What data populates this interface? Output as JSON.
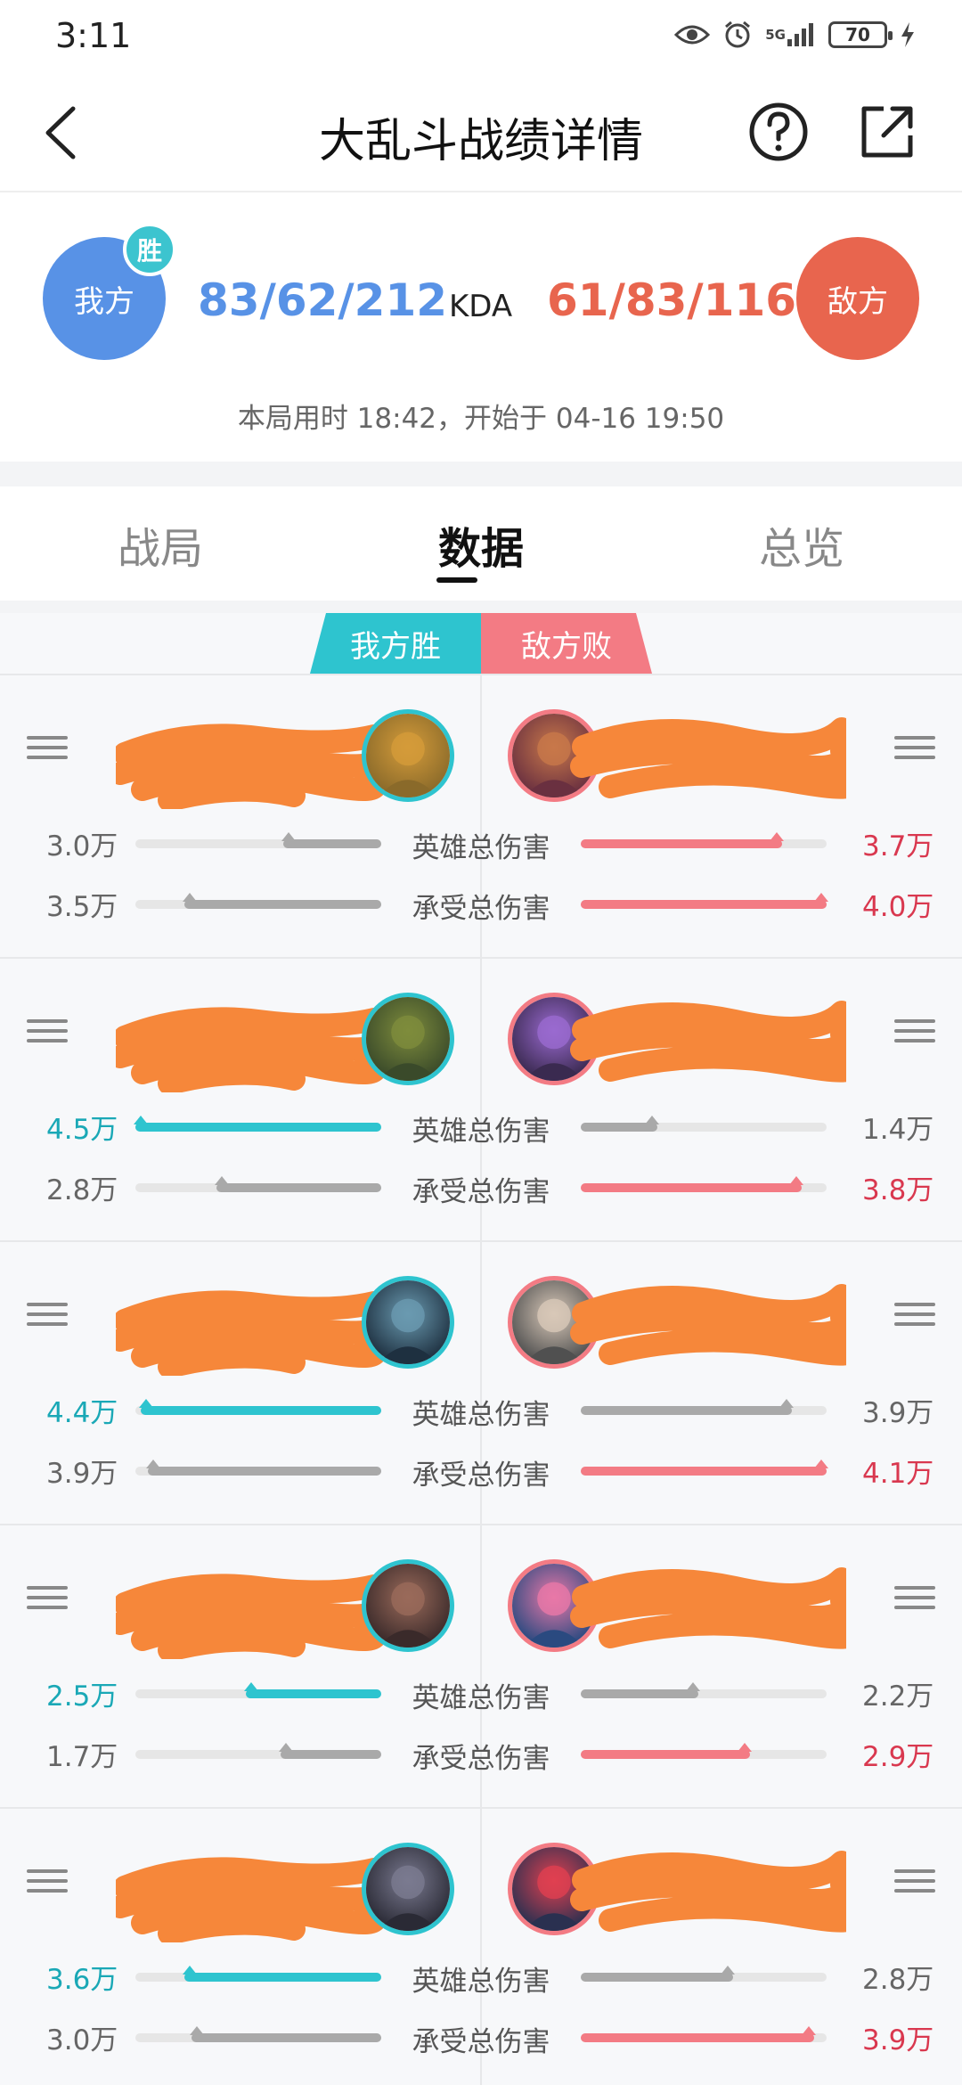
{
  "status_bar": {
    "time": "3:11",
    "battery": "70",
    "signal": "5G",
    "icons": [
      "eye-icon",
      "alarm-icon",
      "signal-icon",
      "battery-icon",
      "charging-icon"
    ]
  },
  "nav": {
    "title": "大乱斗战绩详情",
    "icons": [
      "back-icon",
      "help-icon",
      "share-icon"
    ]
  },
  "summary": {
    "our_label": "我方",
    "win_badge": "胜",
    "their_label": "敌方",
    "our_kda": "83/62/212",
    "kda_label": "KDA",
    "their_kda": "61/83/116",
    "duration": "本局用时 18:42，开始于 04-16 19:50"
  },
  "tabs": [
    "战局",
    "数据",
    "总览"
  ],
  "active_tab": "数据",
  "result": {
    "ours": "我方胜",
    "theirs": "敌方败"
  },
  "labels": {
    "damage": "英雄总伤害",
    "taken": "承受总伤害"
  },
  "colors": {
    "ours_accent": "#2ec4cf",
    "theirs_accent": "#f37b84",
    "highlight_ours": "#1aa8b6",
    "highlight_theirs": "#d9384f",
    "neutral_bar": "#a9a9a9",
    "name_redaction": "#f6873a"
  },
  "rows": [
    {
      "our_damage": "3.0万",
      "our_damage_frac": 0.4,
      "their_damage": "3.7万",
      "their_damage_frac": 0.82,
      "our_taken": "3.5万",
      "our_taken_frac": 0.8,
      "their_taken": "4.0万",
      "their_taken_frac": 1.0,
      "highlight": {
        "our_damage": false,
        "their_damage": true,
        "our_taken": false,
        "their_taken": true
      }
    },
    {
      "our_damage": "4.5万",
      "our_damage_frac": 1.0,
      "their_damage": "1.4万",
      "their_damage_frac": 0.31,
      "our_taken": "2.8万",
      "our_taken_frac": 0.67,
      "their_taken": "3.8万",
      "their_taken_frac": 0.9,
      "highlight": {
        "our_damage": true,
        "their_damage": false,
        "our_taken": false,
        "their_taken": true
      }
    },
    {
      "our_damage": "4.4万",
      "our_damage_frac": 0.98,
      "their_damage": "3.9万",
      "their_damage_frac": 0.86,
      "our_taken": "3.9万",
      "our_taken_frac": 0.95,
      "their_taken": "4.1万",
      "their_taken_frac": 1.0,
      "highlight": {
        "our_damage": true,
        "their_damage": false,
        "our_taken": false,
        "their_taken": true
      }
    },
    {
      "our_damage": "2.5万",
      "our_damage_frac": 0.55,
      "their_damage": "2.2万",
      "their_damage_frac": 0.48,
      "our_taken": "1.7万",
      "our_taken_frac": 0.41,
      "their_taken": "2.9万",
      "their_taken_frac": 0.69,
      "highlight": {
        "our_damage": true,
        "their_damage": false,
        "our_taken": false,
        "their_taken": true
      }
    },
    {
      "our_damage": "3.6万",
      "our_damage_frac": 0.8,
      "their_damage": "2.8万",
      "their_damage_frac": 0.62,
      "our_taken": "3.0万",
      "our_taken_frac": 0.77,
      "their_taken": "3.9万",
      "their_taken_frac": 0.95,
      "highlight": {
        "our_damage": true,
        "their_damage": false,
        "our_taken": false,
        "their_taken": true
      }
    }
  ]
}
